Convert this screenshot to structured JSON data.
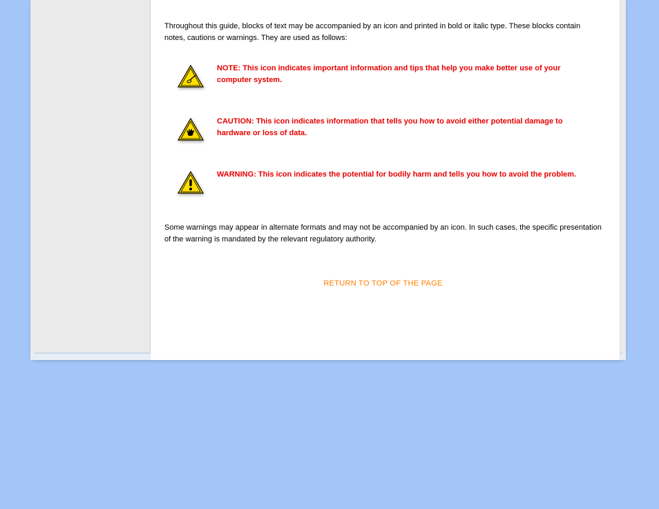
{
  "intro": "Throughout this guide, blocks of text may be accompanied by an icon and printed in bold or italic type. These blocks contain notes, cautions or warnings. They are used as follows:",
  "callouts": [
    {
      "icon": "note-triangle-icon",
      "text": "NOTE: This icon indicates important information and tips that help you make better use of your computer system."
    },
    {
      "icon": "caution-triangle-icon",
      "text": "CAUTION: This icon indicates information that tells you how to avoid either potential damage to hardware or loss of data."
    },
    {
      "icon": "warning-triangle-icon",
      "text": "WARNING: This icon indicates the potential for bodily harm and tells you how to avoid the problem."
    }
  ],
  "footnote": "Some warnings may appear in alternate formats and may not be accompanied by an icon. In such cases, the specific presentation of the warning is mandated by the relevant regulatory authority.",
  "return_link": "RETURN TO TOP OF THE PAGE"
}
